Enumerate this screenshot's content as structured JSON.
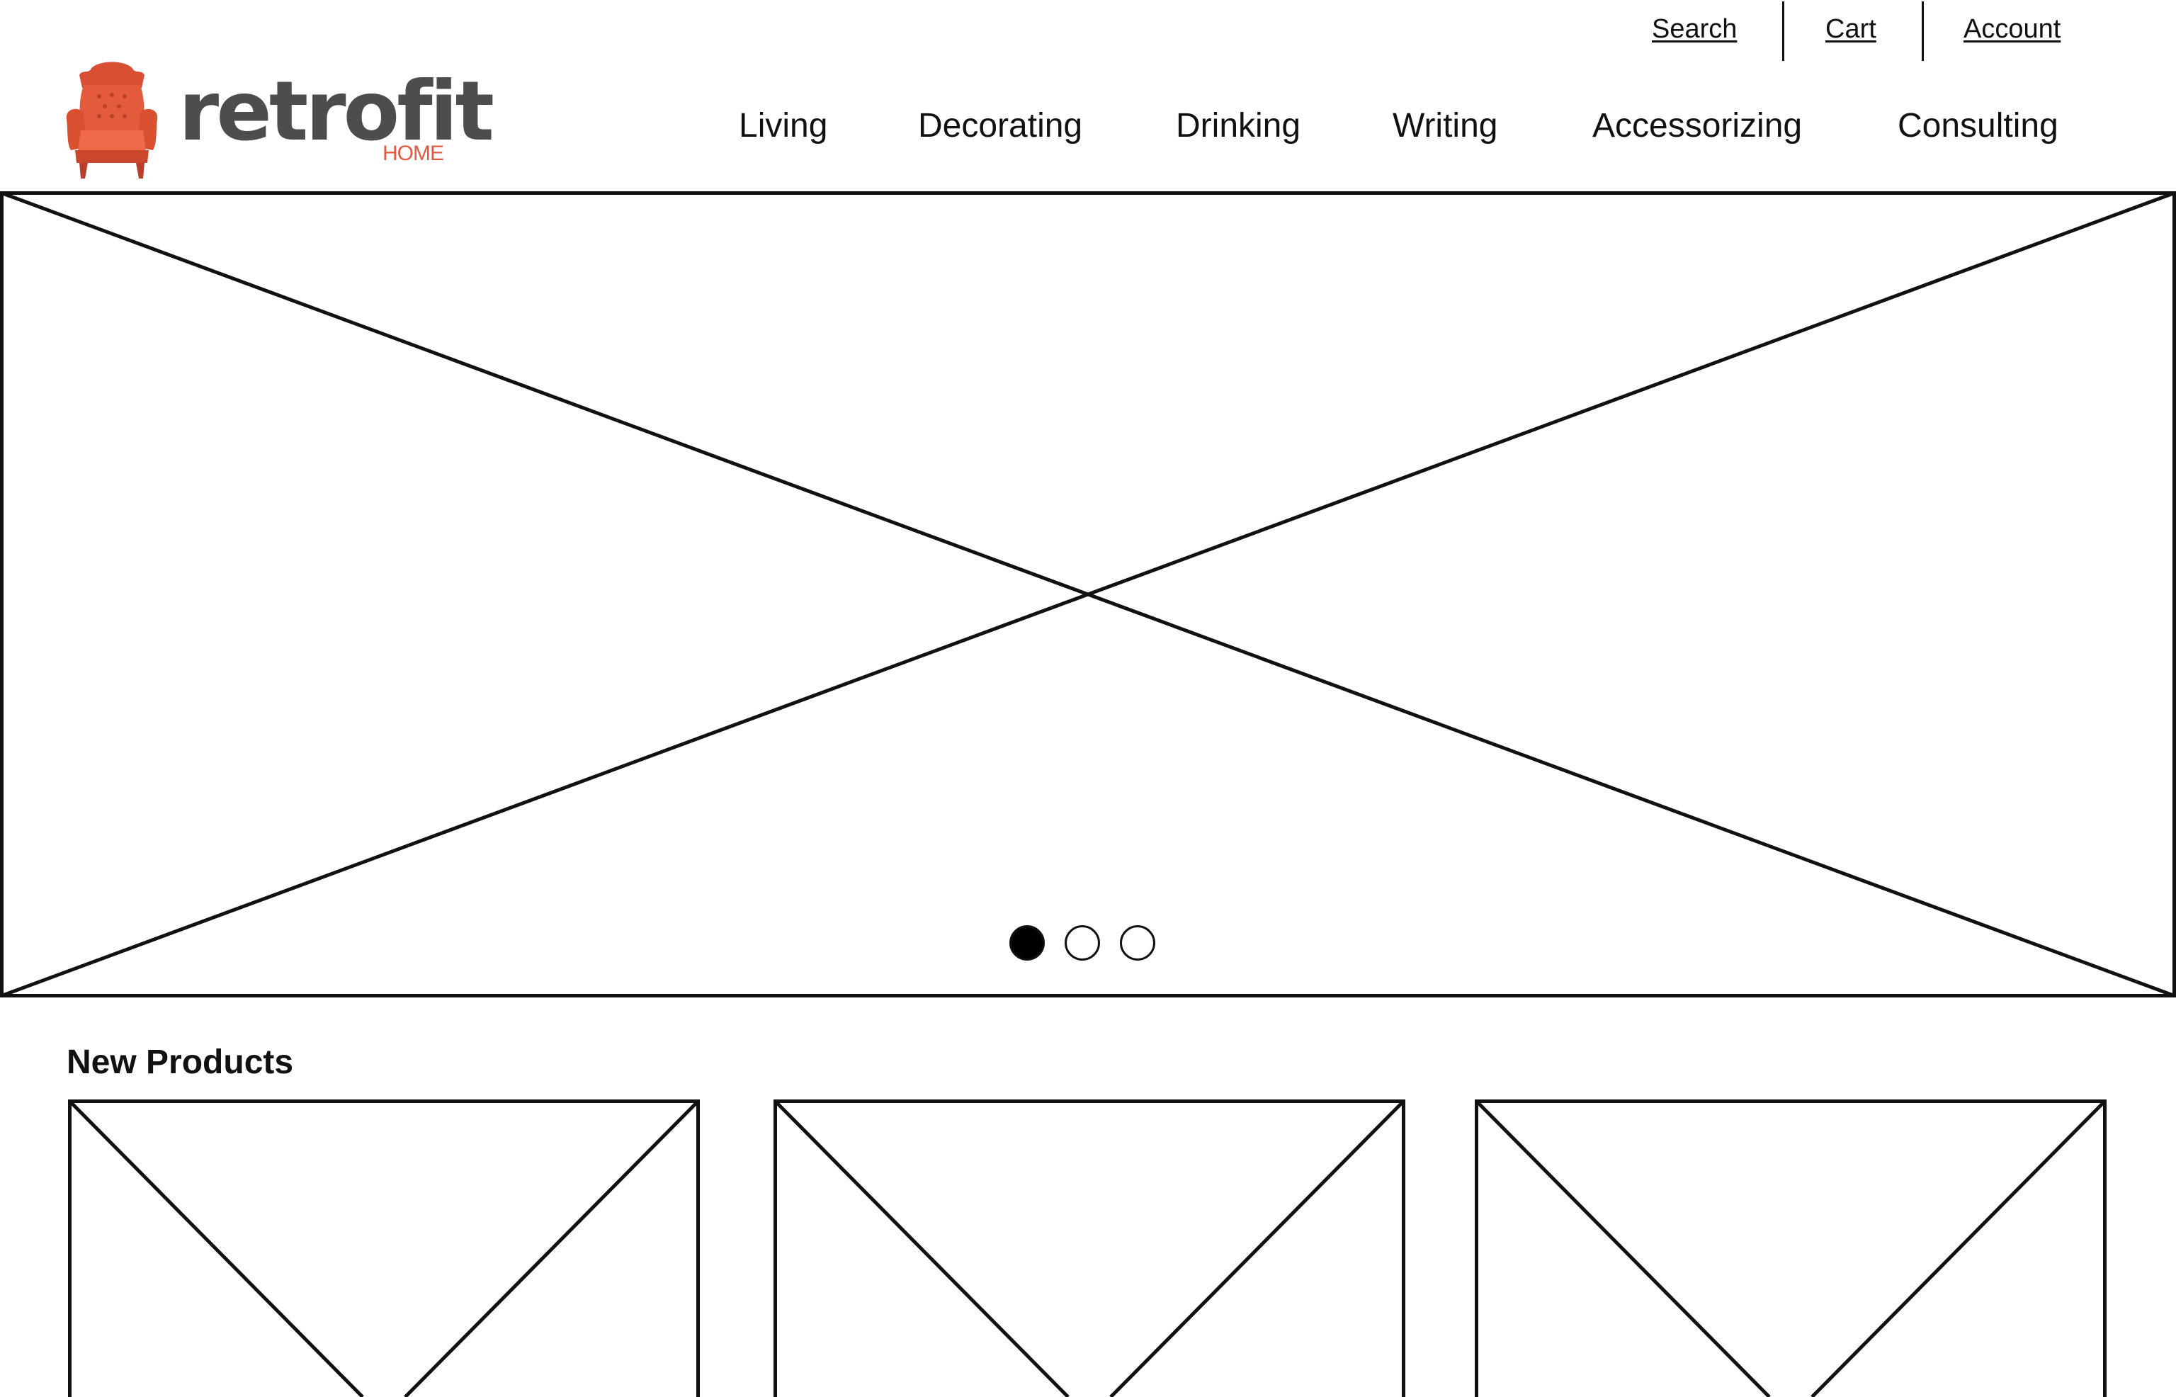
{
  "utility": {
    "search_label": "Search",
    "cart_label": "Cart",
    "account_label": "Account"
  },
  "brand": {
    "name": "retrofit",
    "sub": "HOME",
    "color_word": "#4d4d4d",
    "color_accent": "#e05a3f",
    "icon": "armchair-icon"
  },
  "nav": {
    "items": [
      {
        "label": "Living"
      },
      {
        "label": "Decorating"
      },
      {
        "label": "Drinking"
      },
      {
        "label": "Writing"
      },
      {
        "label": "Accessorizing"
      },
      {
        "label": "Consulting"
      }
    ]
  },
  "hero": {
    "placeholder": "image-placeholder",
    "carousel": {
      "slide_count": 3,
      "active_index": 0
    }
  },
  "products": {
    "title": "New Products",
    "items": [
      {
        "placeholder": "image-placeholder"
      },
      {
        "placeholder": "image-placeholder"
      },
      {
        "placeholder": "image-placeholder"
      }
    ]
  }
}
